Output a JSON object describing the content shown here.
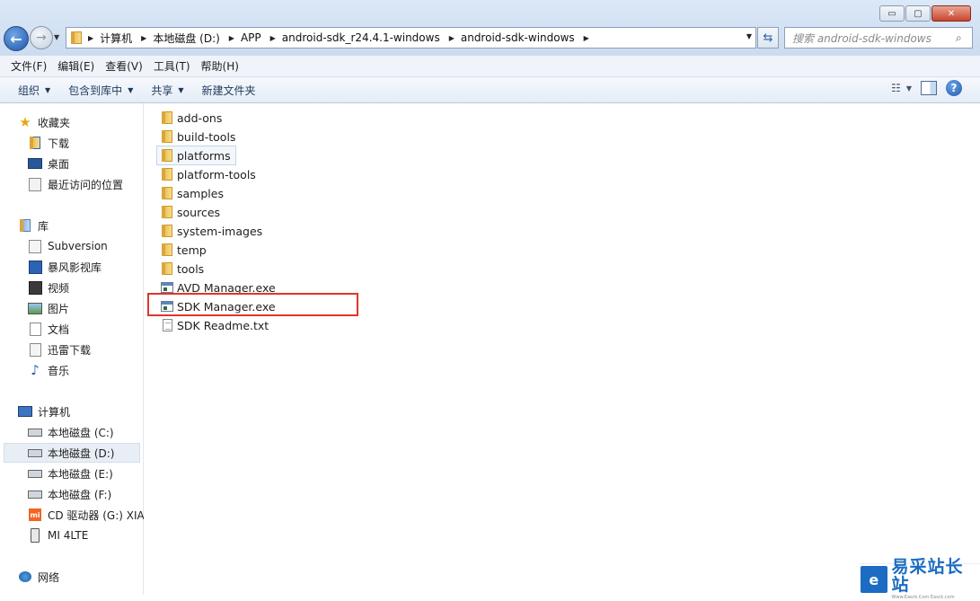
{
  "window": {
    "controls": [
      "▭",
      "▢",
      "✕"
    ]
  },
  "address_bar": {
    "crumbs": [
      "计算机",
      "本地磁盘 (D:)",
      "APP",
      "android-sdk_r24.4.1-windows",
      "android-sdk-windows"
    ]
  },
  "search": {
    "placeholder": "搜索 android-sdk-windows"
  },
  "menu": [
    "文件(F)",
    "编辑(E)",
    "查看(V)",
    "工具(T)",
    "帮助(H)"
  ],
  "toolbar": {
    "organize": "组织",
    "include_library": "包含到库中",
    "share": "共享",
    "new_folder": "新建文件夹"
  },
  "sidebar": {
    "favorites": {
      "title": "收藏夹",
      "items": [
        "下载",
        "桌面",
        "最近访问的位置"
      ]
    },
    "libraries": {
      "title": "库",
      "items": [
        "Subversion",
        "暴风影视库",
        "视频",
        "图片",
        "文档",
        "迅雷下载",
        "音乐"
      ]
    },
    "computer": {
      "title": "计算机",
      "items": [
        "本地磁盘 (C:)",
        "本地磁盘 (D:)",
        "本地磁盘 (E:)",
        "本地磁盘 (F:)",
        "CD 驱动器 (G:) XIA",
        "MI 4LTE"
      ]
    },
    "network": {
      "title": "网络"
    }
  },
  "files": [
    {
      "name": "add-ons",
      "type": "folder"
    },
    {
      "name": "build-tools",
      "type": "folder"
    },
    {
      "name": "platforms",
      "type": "folder"
    },
    {
      "name": "platform-tools",
      "type": "folder"
    },
    {
      "name": "samples",
      "type": "folder"
    },
    {
      "name": "sources",
      "type": "folder"
    },
    {
      "name": "system-images",
      "type": "folder"
    },
    {
      "name": "temp",
      "type": "folder"
    },
    {
      "name": "tools",
      "type": "folder"
    },
    {
      "name": "AVD Manager.exe",
      "type": "exe"
    },
    {
      "name": "SDK Manager.exe",
      "type": "exe"
    },
    {
      "name": "SDK Readme.txt",
      "type": "txt"
    }
  ],
  "watermark": {
    "logo": "e",
    "title": "易采站长站",
    "subtitle": "Www.Easck.Com  Easck.com"
  }
}
